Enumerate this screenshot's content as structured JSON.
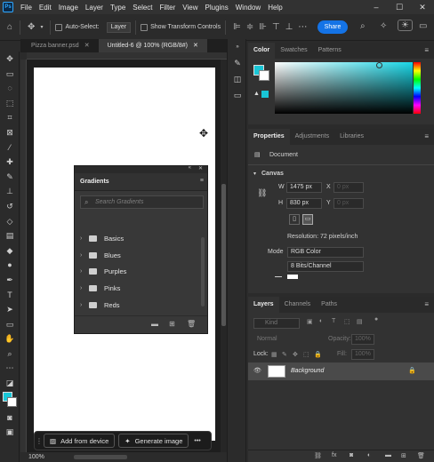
{
  "menu": {
    "logo": "Ps",
    "items": [
      "File",
      "Edit",
      "Image",
      "Layer",
      "Type",
      "Select",
      "Filter",
      "View",
      "Plugins",
      "Window",
      "Help"
    ],
    "window_controls": [
      "–",
      "☐",
      "✕"
    ]
  },
  "options": {
    "auto_select_label": "Auto-Select:",
    "layer_value": "Layer",
    "transform_label": "Show Transform Controls",
    "share_label": "Share"
  },
  "tabs": [
    {
      "label": "Pizza banner.psd",
      "active": false
    },
    {
      "label": "Untitled-6 @ 100% (RGB/8#)",
      "active": true
    }
  ],
  "status": {
    "zoom": "100%"
  },
  "taskbar": {
    "add_device": "Add from device",
    "generate": "Generate image",
    "more": "•••"
  },
  "gradients": {
    "title": "Gradients",
    "search_placeholder": "Search Gradients",
    "folders": [
      "Basics",
      "Blues",
      "Purples",
      "Pinks",
      "Reds"
    ]
  },
  "color_panel": {
    "tabs": [
      "Color",
      "Swatches",
      "Patterns"
    ],
    "fg_color": "#19c6d6",
    "bg_color": "#ffffff"
  },
  "properties": {
    "tabs": [
      "Properties",
      "Adjustments",
      "Libraries"
    ],
    "doc_label": "Document",
    "section": "Canvas",
    "w_label": "W",
    "w_value": "1475 px",
    "h_label": "H",
    "h_value": "830 px",
    "x_label": "X",
    "x_value": "0 px",
    "y_label": "Y",
    "y_value": "0 px",
    "resolution": "Resolution: 72 pixels/inch",
    "mode_label": "Mode",
    "mode_value": "RGB Color",
    "depth_value": "8 Bits/Channel"
  },
  "layers": {
    "tabs": [
      "Layers",
      "Channels",
      "Paths"
    ],
    "kind_placeholder": "Kind",
    "blend": "Normal",
    "opacity_label": "Opacity:",
    "opacity_value": "100%",
    "lock_label": "Lock:",
    "fill_label": "Fill:",
    "fill_value": "100%",
    "layer_name": "Background"
  }
}
